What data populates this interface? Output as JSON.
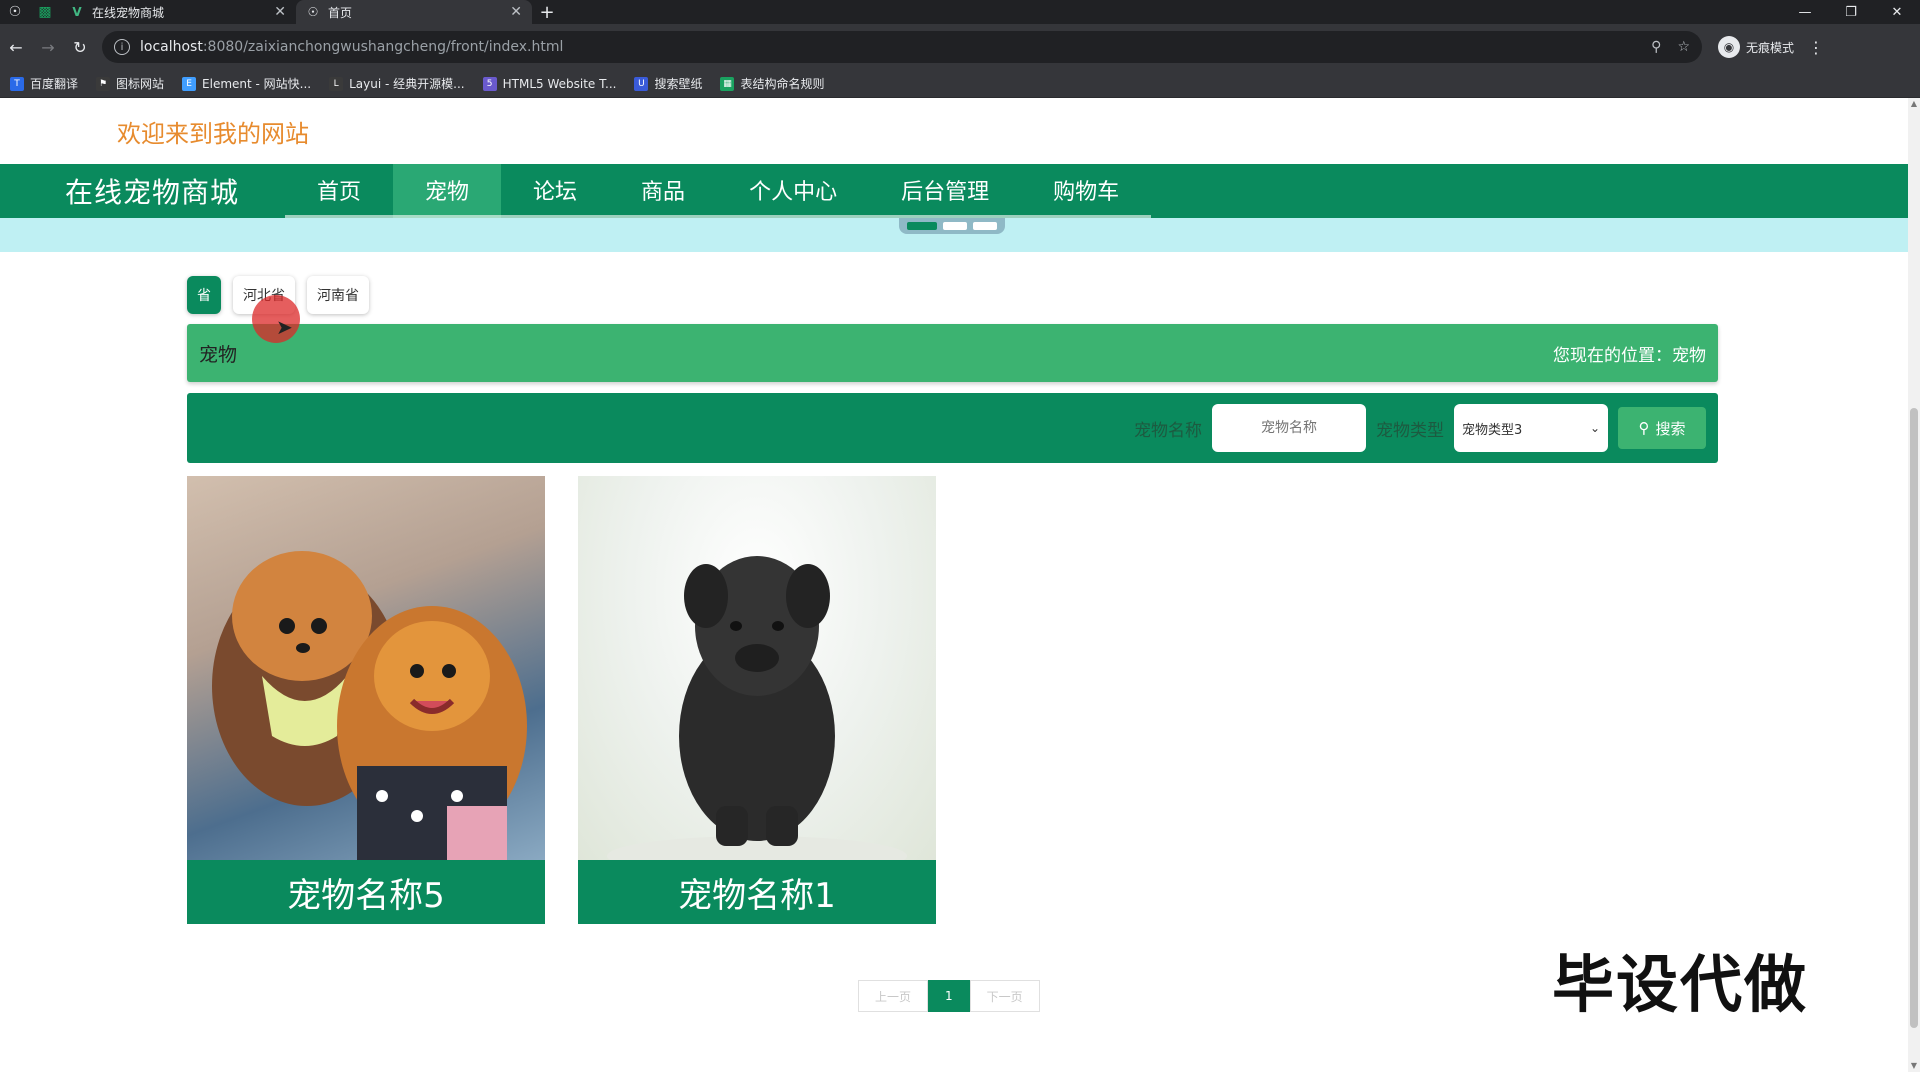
{
  "browser": {
    "tabs": [
      {
        "title": "在线宠物商城",
        "active": false
      },
      {
        "title": "首页",
        "active": true
      }
    ],
    "url_host": "localhost",
    "url_path": ":8080/zaixianchongwushangcheng/front/index.html",
    "profile_label": "无痕模式",
    "bookmarks": [
      {
        "label": "百度翻译",
        "color": "#2a6ae8"
      },
      {
        "label": "图标网站",
        "color": "#3a3a3a"
      },
      {
        "label": "Element - 网站快...",
        "color": "#409eff"
      },
      {
        "label": "Layui - 经典开源模...",
        "color": "#3a3a3a"
      },
      {
        "label": "HTML5 Website T...",
        "color": "#6a5acd"
      },
      {
        "label": "搜索壁纸",
        "color": "#3a5bd9"
      },
      {
        "label": "表结构命名规则",
        "color": "#1aa260"
      }
    ]
  },
  "site": {
    "welcome": "欢迎来到我的网站",
    "brand": "在线宠物商城",
    "nav": [
      "首页",
      "宠物",
      "论坛",
      "商品",
      "个人中心",
      "后台管理",
      "购物车"
    ],
    "active_nav": "宠物",
    "provinces": [
      "省",
      "河北省",
      "河南省"
    ],
    "page_title": "宠物",
    "location_label": "您现在的位置：宠物",
    "search": {
      "name_label": "宠物名称",
      "name_placeholder": "宠物名称",
      "type_label": "宠物类型",
      "type_selected": "宠物类型3",
      "button": "搜索"
    },
    "products": [
      {
        "name": "宠物名称5"
      },
      {
        "name": "宠物名称1"
      }
    ],
    "pager": {
      "prev": "上一页",
      "current": "1",
      "next": "下一页"
    },
    "watermark": "毕设代做",
    "colors": {
      "primary": "#0a8a5d",
      "accent": "#3cb371",
      "welcome": "#e78b2e"
    }
  }
}
